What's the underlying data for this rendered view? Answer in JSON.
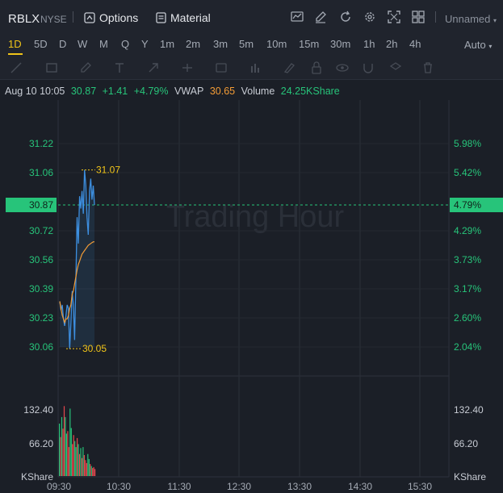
{
  "header": {
    "symbol": "RBLX",
    "exchange": "NYSE",
    "options_label": "Options",
    "material_label": "Material",
    "layout_name": "Unnamed"
  },
  "timeframes": [
    "1D",
    "5D",
    "D",
    "W",
    "M",
    "Q",
    "Y",
    "1m",
    "2m",
    "3m",
    "5m",
    "10m",
    "15m",
    "30m",
    "1h",
    "2h",
    "4h"
  ],
  "active_timeframe": "1D",
  "scale_mode": "Auto",
  "quote": {
    "datetime": "Aug 10 10:05",
    "price": "30.87",
    "change": "+1.41",
    "change_pct": "+4.79%",
    "vwap_label": "VWAP",
    "vwap_value": "30.65",
    "volume_label": "Volume",
    "volume_value": "24.25KShare"
  },
  "watermark": "Trading Hour",
  "colors": {
    "up": "#27c47a",
    "down": "#e5484d",
    "price_line": "#3d8fe0",
    "vwap_line": "#f39c36",
    "marker": "#f0c419"
  },
  "chart_data": {
    "type": "line",
    "x_ticks": [
      "09:30",
      "10:30",
      "11:30",
      "12:30",
      "13:30",
      "14:30",
      "15:30"
    ],
    "price_ticks": [
      "31.22",
      "31.06",
      "30.72",
      "30.56",
      "30.39",
      "30.23",
      "30.06"
    ],
    "pct_ticks": [
      "5.98%",
      "5.42%",
      "4.29%",
      "3.73%",
      "3.17%",
      "2.60%",
      "2.04%"
    ],
    "current_price": "30.87",
    "current_pct": "4.79%",
    "high_marker": "31.07",
    "low_marker": "30.05",
    "series": [
      {
        "name": "Price",
        "values": [
          30.32,
          30.27,
          30.3,
          30.22,
          30.18,
          30.24,
          30.3,
          30.28,
          30.05,
          30.2,
          30.38,
          30.3,
          30.1,
          30.45,
          30.8,
          30.65,
          30.92,
          30.85,
          30.95,
          30.82,
          31.07,
          30.98,
          30.8,
          30.7,
          30.95,
          31.02,
          30.9,
          30.98,
          30.87
        ]
      },
      {
        "name": "VWAP",
        "values": [
          30.32,
          30.28,
          30.24,
          30.22,
          30.2,
          30.22,
          30.22,
          30.24,
          30.28,
          30.3,
          30.36,
          30.38,
          30.42,
          30.46,
          30.5,
          30.53,
          30.55,
          30.57,
          30.59,
          30.6,
          30.61,
          30.62,
          30.63,
          30.64,
          30.645,
          30.65,
          30.655,
          30.66,
          30.66
        ]
      }
    ],
    "volume": {
      "unit": "KShare",
      "ticks": [
        "132.40",
        "66.20"
      ],
      "values": [
        105,
        78,
        118,
        95,
        140,
        118,
        85,
        90,
        58,
        135,
        96,
        64,
        82,
        70,
        58,
        76,
        64,
        44,
        56,
        36,
        58,
        42,
        32,
        26,
        44,
        34,
        24,
        20,
        16,
        18,
        14
      ]
    }
  }
}
